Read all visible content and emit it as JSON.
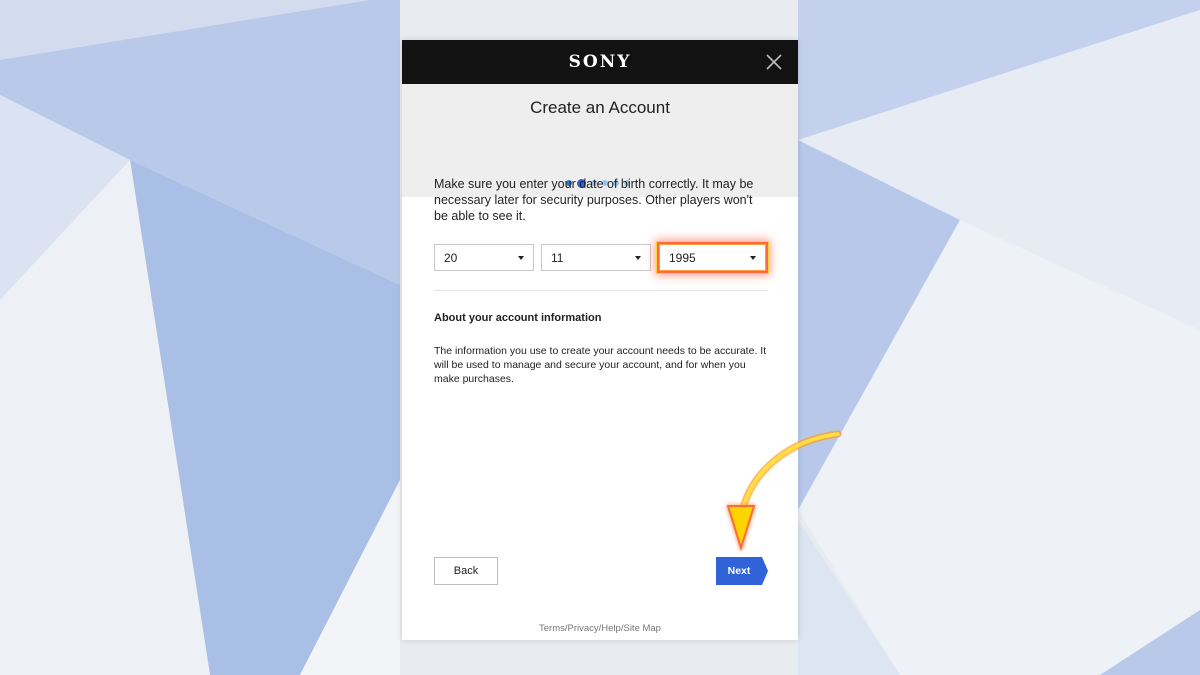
{
  "colors": {
    "topbar": "#121212",
    "header_bg": "#eeeeee",
    "accent_blue": "#2f63d7",
    "highlight": "#ff6a3d",
    "annotation_arrow": "#ffd400"
  },
  "brand": {
    "logo_text": "SONY"
  },
  "dialog": {
    "close_icon": "close-icon",
    "title": "Create an Account",
    "progress": {
      "total_steps": 6,
      "current_step": 2
    },
    "intro_text": "Make sure you enter your date of birth correctly. It may be necessary later for security purposes. Other players won't be able to see it.",
    "dob": {
      "day": "20",
      "month": "11",
      "year": "1995"
    },
    "about": {
      "title": "About your account information",
      "text": "The information you use to create your account needs to be accurate. It will be used to manage and secure your account, and for when you make purchases."
    },
    "buttons": {
      "back": "Back",
      "next": "Next"
    },
    "footer": "Terms/Privacy/Help/Site Map"
  }
}
